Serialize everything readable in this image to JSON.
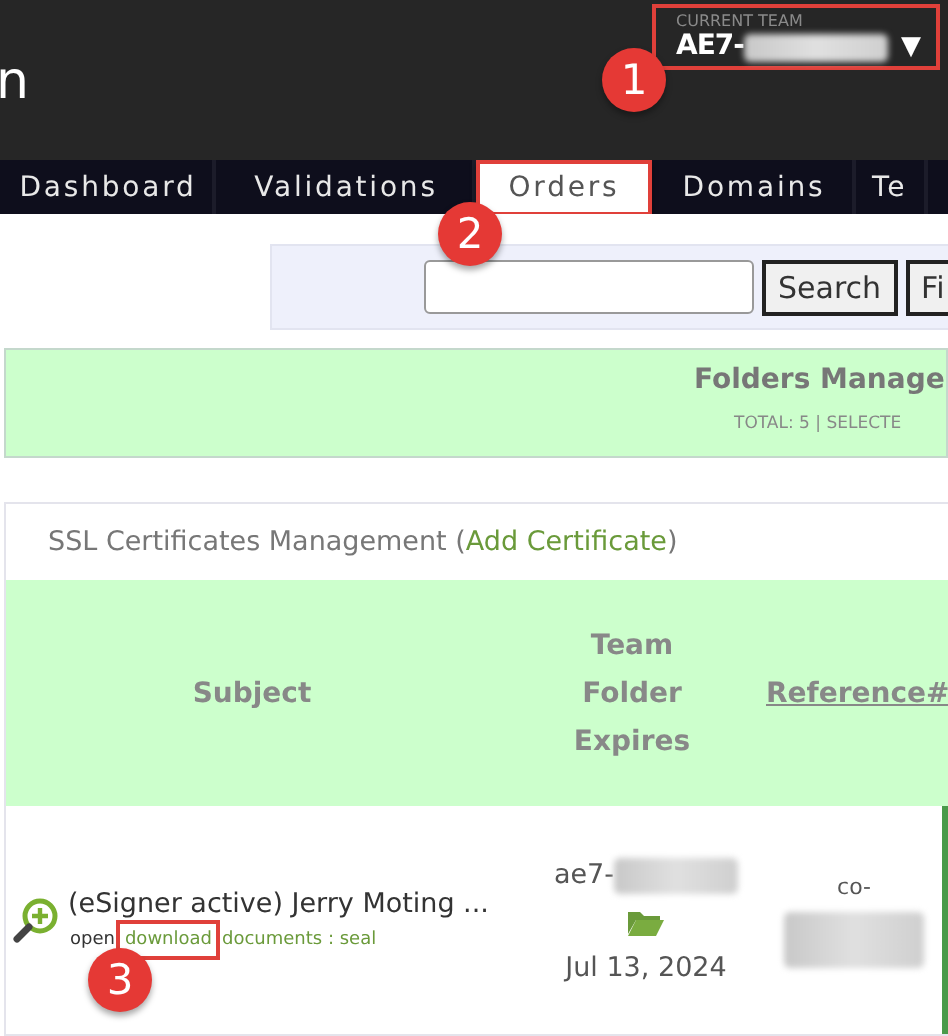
{
  "header": {
    "title_fragment": "n",
    "team_switcher": {
      "label": "CURRENT TEAM",
      "value": "AE7-",
      "caret": "▼",
      "highlighted": true
    }
  },
  "tabs": [
    {
      "label": "Dashboard",
      "selected": false,
      "highlighted": false
    },
    {
      "label": "Validations",
      "selected": false,
      "highlighted": false
    },
    {
      "label": "Orders",
      "selected": true,
      "highlighted": true
    },
    {
      "label": "Domains",
      "selected": false,
      "highlighted": false
    },
    {
      "label": "Te",
      "selected": false,
      "highlighted": false
    }
  ],
  "search": {
    "button": "Search",
    "filter_button": "Fi"
  },
  "folders": {
    "title": "Folders Manage",
    "summary": "TOTAL: 5 | SELECTE"
  },
  "certificates": {
    "title": "SSL Certificates Management (",
    "link": "Add Certificate",
    "title_end": ")",
    "columns": [
      {
        "kind": "text",
        "lines": [
          "Subject"
        ]
      },
      {
        "kind": "text",
        "lines": [
          "Team",
          "Folder",
          "Expires"
        ]
      },
      {
        "kind": "link",
        "lines": [
          "Reference#"
        ]
      }
    ],
    "rows": [
      {
        "subject": "(eSigner active) Jerry Moting ...",
        "team": "ae7-",
        "expires": "Jul 13, 2024",
        "reference": "co-",
        "actions": [
          {
            "label": "open",
            "kind": "text",
            "highlighted": false
          },
          {
            "label": "download",
            "kind": "link",
            "highlighted": true
          },
          {
            "label": "documents : seal",
            "kind": "link",
            "highlighted": false
          }
        ]
      }
    ]
  },
  "callouts": [
    "1",
    "2",
    "3"
  ]
}
